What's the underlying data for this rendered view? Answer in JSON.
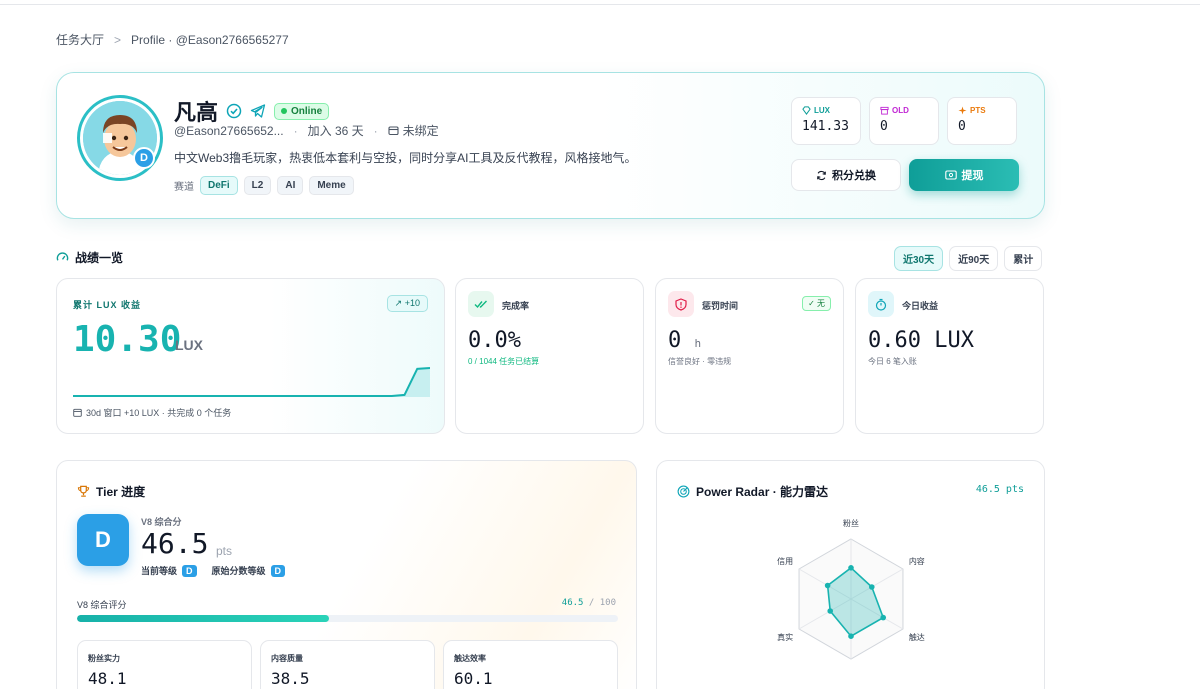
{
  "breadcrumb": {
    "root": "任务大厅",
    "separator": ">",
    "current": "Profile · @Eason2766565277"
  },
  "profile": {
    "name": "凡高",
    "status": "Online",
    "tier": "D",
    "handle": "@Eason27665652...",
    "joined": "加入 36 天",
    "binding": "未绑定",
    "bio": "中文Web3撸毛玩家，热衷低本套利与空投，同时分享AI工具及反代教程，风格接地气。",
    "track_label": "赛道",
    "tags": [
      "DeFi",
      "L2",
      "AI",
      "Meme"
    ]
  },
  "balances": [
    {
      "label": "LUX",
      "value": "141.33",
      "color": "#0f9e98"
    },
    {
      "label": "OLD",
      "value": "0",
      "color": "#c026d3"
    },
    {
      "label": "PTS",
      "value": "0",
      "color": "#ea7a0c"
    }
  ],
  "actions": {
    "exchange": "积分兑换",
    "withdraw": "提现"
  },
  "performance": {
    "title": "战绩一览",
    "ranges": [
      "近30天",
      "近90天",
      "累计"
    ],
    "active_range": "近30天"
  },
  "lux_card": {
    "label": "累计 LUX 收益",
    "delta": "+10",
    "value": "10.30",
    "unit": "LUX",
    "footer": "30d 窗口 +10 LUX · 共完成 0 个任务",
    "trend": [
      0,
      0,
      0,
      0,
      0,
      0,
      0,
      0,
      0,
      0,
      0,
      0,
      0,
      0,
      0,
      0,
      0,
      0,
      0,
      0,
      0,
      0,
      0,
      0,
      0,
      0,
      0.4,
      10,
      10.3
    ]
  },
  "completion": {
    "label": "完成率",
    "value": "0.0%",
    "sub": "0 / 1044 任务已结算",
    "accent": "#10b981"
  },
  "penalty": {
    "label": "惩罚时间",
    "value": "0",
    "unit": "h",
    "badge": "✓ 无",
    "sub": "信誉良好 · 零违规",
    "accent": "#e11d48"
  },
  "today": {
    "label": "今日收益",
    "value": "0.60 LUX",
    "sub": "今日 6 笔入账",
    "accent": "#0ea5b7"
  },
  "tier_panel": {
    "title": "Tier 进度",
    "tier": "D",
    "score_label": "V8 综合分",
    "score": "46.5",
    "unit": "pts",
    "current_level_label": "当前等级",
    "current_level": "D",
    "raw_level_label": "原始分数等级",
    "raw_level": "D",
    "progress_label": "V8 综合评分",
    "progress_value": "46.5",
    "progress_total": "/ 100",
    "progress_fraction": 0.465,
    "subs": [
      {
        "label": "粉丝实力",
        "value": "48.1"
      },
      {
        "label": "内容质量",
        "value": "38.5"
      },
      {
        "label": "触达效率",
        "value": "60.1"
      }
    ]
  },
  "radar": {
    "title": "Power Radar · 能力雷达",
    "points": "46.5 pts",
    "axes": [
      "粉丝",
      "内容",
      "触达",
      "",
      "真实",
      "信用"
    ],
    "values": [
      0.52,
      0.4,
      0.62,
      0.62,
      0.4,
      0.45
    ]
  }
}
